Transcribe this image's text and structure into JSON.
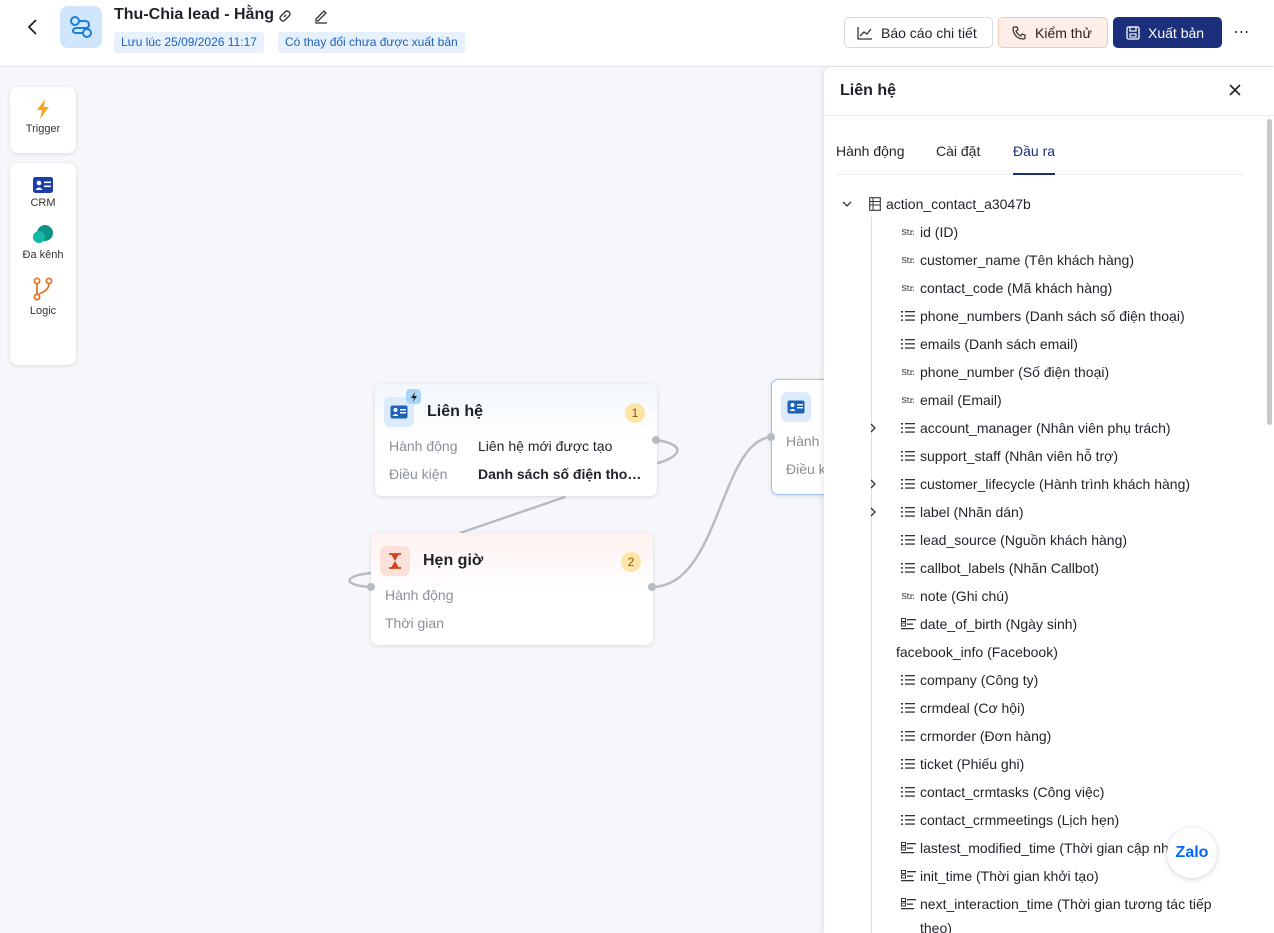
{
  "header": {
    "title": "Thu-Chia lead - Hằng",
    "saved_at": "Lưu lúc 25/09/2026 11:17",
    "unpublished": "Có thay đổi chưa được xuất bản",
    "report_label": "Báo cáo chi tiết",
    "test_label": "Kiểm thử",
    "publish_label": "Xuất bản"
  },
  "palette": {
    "trigger": "Trigger",
    "crm": "CRM",
    "multichannel": "Đa kênh",
    "logic": "Logic"
  },
  "nodes": {
    "contact": {
      "title": "Liên hệ",
      "badge": "1",
      "row1_label": "Hành động",
      "row1_value": "Liên hệ mới được tạo",
      "row2_label": "Điều kiện",
      "row2_value": "Danh sách số điện thoại ..."
    },
    "timer": {
      "title": "Hẹn giờ",
      "badge": "2",
      "row1_label": "Hành động",
      "row2_label": "Thời gian"
    },
    "partial": {
      "row1_label": "Hành",
      "row2_label": "Điều k"
    }
  },
  "panel": {
    "title": "Liên hệ",
    "tabs": [
      "Hành động",
      "Cài đặt",
      "Đầu ra"
    ],
    "active_tab": 2,
    "root": "action_contact_a3047b",
    "items": [
      {
        "label": "id (ID)",
        "icon": "str-icon",
        "expand": false
      },
      {
        "label": "customer_name (Tên khách hàng)",
        "icon": "str-icon",
        "expand": false
      },
      {
        "label": "contact_code (Mã khách hàng)",
        "icon": "str-icon",
        "expand": false
      },
      {
        "label": "phone_numbers (Danh sách số điện thoại)",
        "icon": "list-icon",
        "expand": false
      },
      {
        "label": "emails (Danh sách email)",
        "icon": "list-icon",
        "expand": false
      },
      {
        "label": "phone_number (Số điện thoại)",
        "icon": "str-icon",
        "expand": false
      },
      {
        "label": "email (Email)",
        "icon": "str-icon",
        "expand": false
      },
      {
        "label": "account_manager (Nhân viên phụ trách)",
        "icon": "list-icon",
        "expand": true
      },
      {
        "label": "support_staff (Nhân viên hỗ trợ)",
        "icon": "list-icon",
        "expand": false
      },
      {
        "label": "customer_lifecycle (Hành trình khách hàng)",
        "icon": "list-icon",
        "expand": true
      },
      {
        "label": "label (Nhãn dán)",
        "icon": "list-icon",
        "expand": true
      },
      {
        "label": "lead_source (Nguồn khách hàng)",
        "icon": "list-icon",
        "expand": false
      },
      {
        "label": "callbot_labels (Nhãn Callbot)",
        "icon": "list-icon",
        "expand": false
      },
      {
        "label": "note (Ghi chú)",
        "icon": "str-icon",
        "expand": false
      },
      {
        "label": "date_of_birth (Ngày sinh)",
        "icon": "datetime-icon",
        "expand": false
      },
      {
        "label": "facebook_info (Facebook)",
        "icon": "none",
        "expand": false
      },
      {
        "label": "company (Công ty)",
        "icon": "list-icon",
        "expand": false
      },
      {
        "label": "crmdeal (Cơ hội)",
        "icon": "list-icon",
        "expand": false
      },
      {
        "label": "crmorder (Đơn hàng)",
        "icon": "list-icon",
        "expand": false
      },
      {
        "label": "ticket (Phiếu ghi)",
        "icon": "list-icon",
        "expand": false
      },
      {
        "label": "contact_crmtasks (Công việc)",
        "icon": "list-icon",
        "expand": false
      },
      {
        "label": "contact_crmmeetings (Lịch hẹn)",
        "icon": "list-icon",
        "expand": false
      },
      {
        "label": "lastest_modified_time (Thời gian cập nh",
        "icon": "datetime-icon",
        "expand": false
      },
      {
        "label": "init_time (Thời gian khởi tạo)",
        "icon": "datetime-icon",
        "expand": false
      },
      {
        "label": "next_interaction_time (Thời gian tương tác tiếp",
        "icon": "datetime-icon",
        "expand": false
      },
      {
        "label": "theo)",
        "icon": "none",
        "expand": false
      }
    ]
  },
  "zalo": "Zalo",
  "colors": {
    "primary": "#1b2f7c",
    "chip_bg": "#e6f1fd",
    "badge_bg": "#fde5a8"
  }
}
